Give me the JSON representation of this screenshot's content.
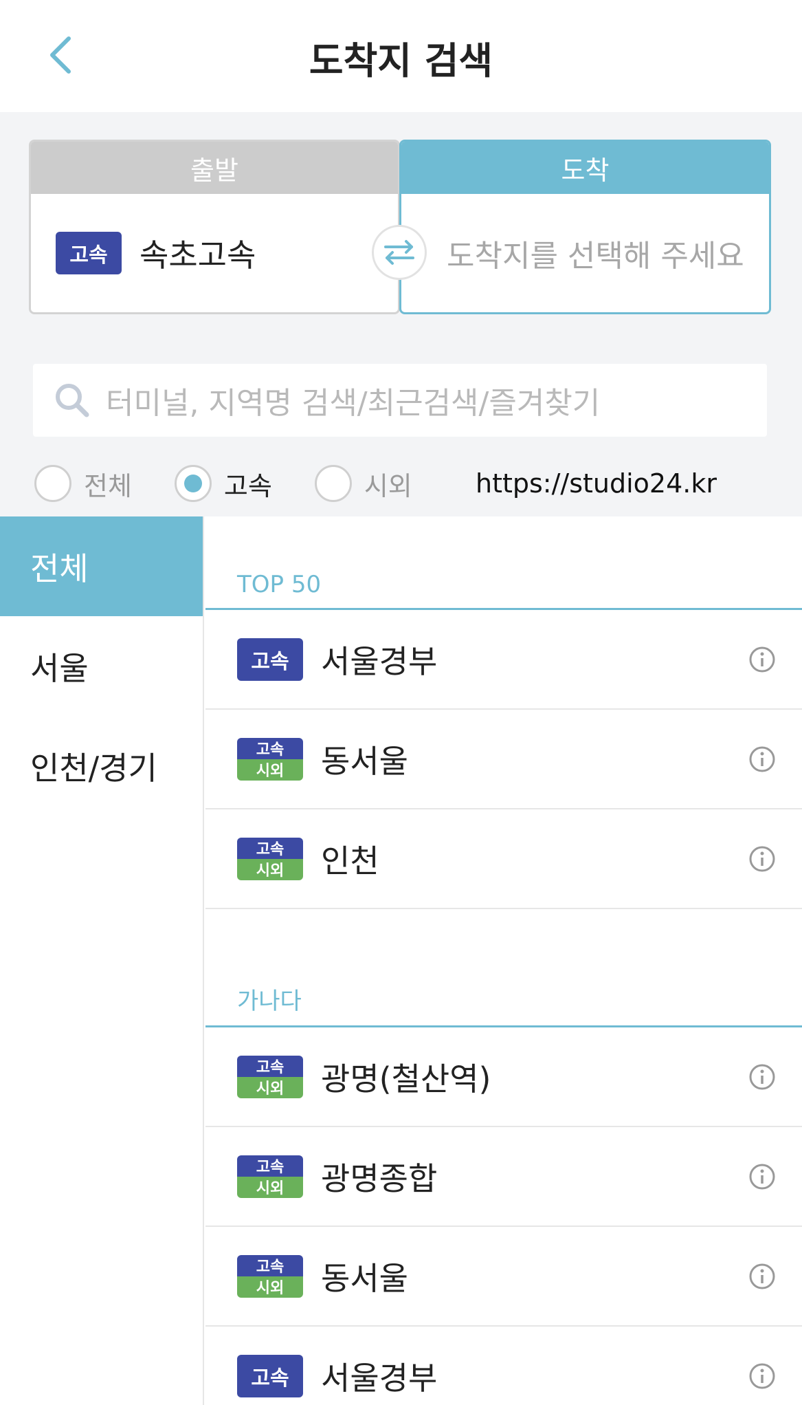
{
  "header": {
    "title": "도착지 검색",
    "back_icon": "chevron-left-icon"
  },
  "route": {
    "depart_label": "출발",
    "arrive_label": "도착",
    "depart_badge": "고속",
    "depart_name": "속초고속",
    "arrive_placeholder": "도착지를 선택해 주세요",
    "swap_icon": "swap-arrows-icon"
  },
  "search": {
    "placeholder": "터미널, 지역명 검색/최근검색/즐겨찾기",
    "icon": "search-icon"
  },
  "filters": [
    {
      "label": "전체",
      "checked": false
    },
    {
      "label": "고속",
      "checked": true
    },
    {
      "label": "시외",
      "checked": false
    }
  ],
  "watermark": "https://studio24.kr",
  "regions": [
    {
      "label": "전체",
      "active": true
    },
    {
      "label": "서울",
      "active": false
    },
    {
      "label": "인천/경기",
      "active": false
    }
  ],
  "sections": [
    {
      "title": "TOP 50",
      "items": [
        {
          "name": "서울경부",
          "badge_type": "single",
          "badge_top": "고속"
        },
        {
          "name": "동서울",
          "badge_type": "dual",
          "badge_top": "고속",
          "badge_bottom": "시외"
        },
        {
          "name": "인천",
          "badge_type": "dual",
          "badge_top": "고속",
          "badge_bottom": "시외"
        }
      ]
    },
    {
      "title": "가나다",
      "items": [
        {
          "name": "광명(철산역)",
          "badge_type": "dual",
          "badge_top": "고속",
          "badge_bottom": "시외"
        },
        {
          "name": "광명종합",
          "badge_type": "dual",
          "badge_top": "고속",
          "badge_bottom": "시외"
        },
        {
          "name": "동서울",
          "badge_type": "dual",
          "badge_top": "고속",
          "badge_bottom": "시외"
        },
        {
          "name": "서울경부",
          "badge_type": "single",
          "badge_top": "고속"
        }
      ]
    }
  ],
  "colors": {
    "accent": "#6fbbd3",
    "express_badge": "#3c4aa3",
    "intercity_badge": "#6ab15a",
    "depart_head": "#cccccc"
  }
}
